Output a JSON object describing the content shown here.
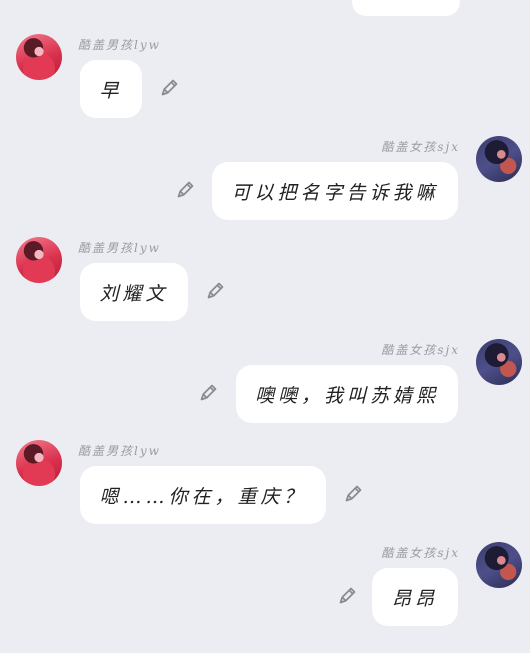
{
  "colors": {
    "background": "#ecedf2",
    "bubble": "#ffffff",
    "name_text": "#9a9ba3",
    "icon": "#8a8b92"
  },
  "icons": [
    "edit-pencil-icon"
  ],
  "messages": [
    {
      "side": "left",
      "sender": "酷盖男孩lyw",
      "text": "早"
    },
    {
      "side": "right",
      "sender": "酷盖女孩sjx",
      "text": "可以把名字告诉我嘛"
    },
    {
      "side": "left",
      "sender": "酷盖男孩lyw",
      "text": "刘耀文"
    },
    {
      "side": "right",
      "sender": "酷盖女孩sjx",
      "text": "噢噢，我叫苏婧熙"
    },
    {
      "side": "left",
      "sender": "酷盖男孩lyw",
      "text": "嗯……你在，重庆？"
    },
    {
      "side": "right",
      "sender": "酷盖女孩sjx",
      "text": "昂昂"
    }
  ]
}
